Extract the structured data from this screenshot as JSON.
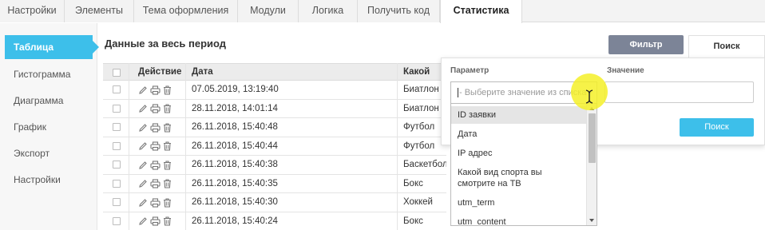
{
  "tabs": [
    {
      "label": "Настройки"
    },
    {
      "label": "Элементы"
    },
    {
      "label": "Тема оформления"
    },
    {
      "label": "Модули"
    },
    {
      "label": "Логика"
    },
    {
      "label": "Получить код"
    },
    {
      "label": "Статистика",
      "active": true
    }
  ],
  "sidebar": {
    "items": [
      {
        "label": "Таблица",
        "active": true
      },
      {
        "label": "Гистограмма"
      },
      {
        "label": "Диаграмма"
      },
      {
        "label": "График"
      },
      {
        "label": "Экспорт"
      },
      {
        "label": "Настройки"
      }
    ]
  },
  "main": {
    "title": "Данные за весь период",
    "columns": {
      "action": "Действие",
      "date": "Дата",
      "sport": "Какой вид"
    },
    "row_icons": [
      "pencil-icon",
      "printer-icon",
      "trash-icon"
    ],
    "rows": [
      {
        "date": "07.05.2019, 13:19:40",
        "sport": "Биатлон"
      },
      {
        "date": "28.11.2018, 14:01:14",
        "sport": "Биатлон"
      },
      {
        "date": "26.11.2018, 15:40:48",
        "sport": "Футбол"
      },
      {
        "date": "26.11.2018, 15:40:44",
        "sport": "Футбол"
      },
      {
        "date": "26.11.2018, 15:40:38",
        "sport": "Баскетбол"
      },
      {
        "date": "26.11.2018, 15:40:35",
        "sport": "Бокс"
      },
      {
        "date": "26.11.2018, 15:40:30",
        "sport": "Хоккей"
      },
      {
        "date": "26.11.2018, 15:40:24",
        "sport": "Бокс"
      }
    ]
  },
  "toolbar": {
    "filter_label": "Фильтр",
    "search_tab_label": "Поиск"
  },
  "filter_panel": {
    "param_label": "Параметр",
    "value_label": "Значение",
    "select_placeholder": "- Выберите значение из списка -",
    "search_button": "Поиск",
    "options": [
      {
        "label": "ID заявки",
        "highlighted": true
      },
      {
        "label": "Дата"
      },
      {
        "label": "IP адрес"
      },
      {
        "label": "Какой вид спорта вы смотрите на ТВ"
      },
      {
        "label": "utm_term"
      },
      {
        "label": "utm_content"
      }
    ]
  },
  "colors": {
    "accent": "#3dbfea",
    "filter_button": "#7c8497",
    "cursor_highlight": "#f5f028"
  }
}
